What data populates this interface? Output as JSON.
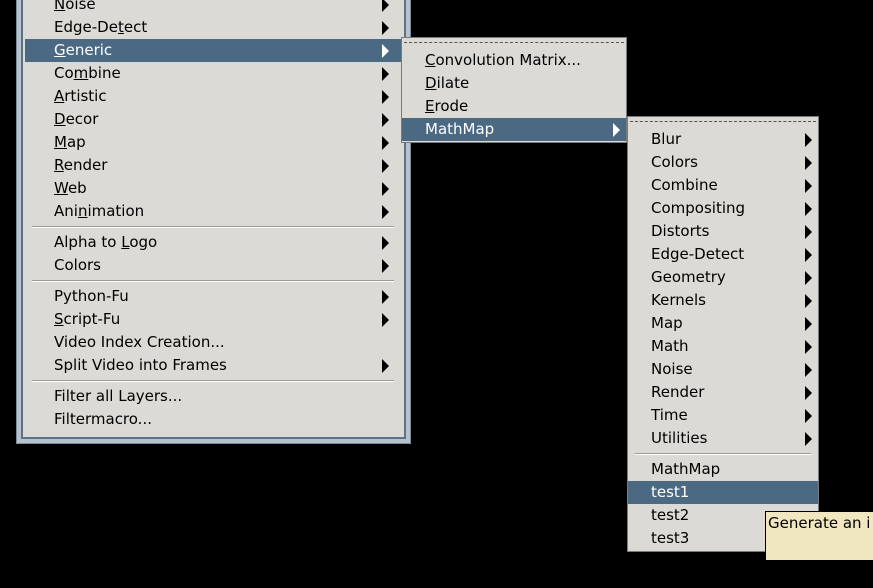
{
  "menu1": {
    "items": [
      {
        "label": "Noise",
        "ul": "N",
        "pre": "",
        "post": "oise",
        "submenu": true
      },
      {
        "label": "Edge-Detect",
        "ul": "t",
        "pre": "Edge-De",
        "post": "ect",
        "submenu": true
      },
      {
        "label": "Generic",
        "ul": "G",
        "pre": "",
        "post": "eneric",
        "submenu": true,
        "active": true
      },
      {
        "label": "Combine",
        "ul": "m",
        "pre": "Co",
        "post": "bine",
        "submenu": true
      },
      {
        "label": "Artistic",
        "ul": "A",
        "pre": "",
        "post": "rtistic",
        "submenu": true
      },
      {
        "label": "Decor",
        "ul": "D",
        "pre": "",
        "post": "ecor",
        "submenu": true
      },
      {
        "label": "Map",
        "ul": "M",
        "pre": "",
        "post": "ap",
        "submenu": true
      },
      {
        "label": "Render",
        "ul": "R",
        "pre": "",
        "post": "ender",
        "submenu": true
      },
      {
        "label": "Web",
        "ul": "W",
        "pre": "",
        "post": "eb",
        "submenu": true
      },
      {
        "label": "Animation",
        "ul": "n",
        "pre": "Ani",
        "post": "imation",
        "submenu": true
      },
      {
        "label": "Alpha to Logo",
        "ul": "L",
        "pre": "Alpha to ",
        "post": "ogo",
        "submenu": true
      },
      {
        "label": "Colors",
        "ul": "",
        "pre": "Colors",
        "post": "",
        "submenu": true
      },
      {
        "label": "Python-Fu",
        "ul": "",
        "pre": "Python-Fu",
        "post": "",
        "submenu": true
      },
      {
        "label": "Script-Fu",
        "ul": "S",
        "pre": "",
        "post": "cript-Fu",
        "submenu": true
      },
      {
        "label": "Video Index Creation...",
        "ul": "",
        "pre": "Video Index Creation...",
        "post": "",
        "submenu": false
      },
      {
        "label": "Split Video into Frames",
        "ul": "",
        "pre": "Split Video into Frames",
        "post": "",
        "submenu": true
      },
      {
        "label": "Filter all Layers...",
        "ul": "",
        "pre": "Filter all Layers...",
        "post": "",
        "submenu": false
      },
      {
        "label": "Filtermacro...",
        "ul": "",
        "pre": "Filtermacro...",
        "post": "",
        "submenu": false
      }
    ]
  },
  "menu2": {
    "items": [
      {
        "label": "Convolution Matrix...",
        "ul": "C",
        "pre": "",
        "post": "onvolution Matrix...",
        "submenu": false
      },
      {
        "label": "Dilate",
        "ul": "D",
        "pre": "",
        "post": "ilate",
        "submenu": false
      },
      {
        "label": "Erode",
        "ul": "E",
        "pre": "",
        "post": "rode",
        "submenu": false
      },
      {
        "label": "MathMap",
        "ul": "",
        "pre": "MathMap",
        "post": "",
        "submenu": true,
        "active": true
      }
    ]
  },
  "menu3": {
    "categories": [
      "Blur",
      "Colors",
      "Combine",
      "Compositing",
      "Distorts",
      "Edge-Detect",
      "Geometry",
      "Kernels",
      "Map",
      "Math",
      "Noise",
      "Render",
      "Time",
      "Utilities"
    ],
    "items": [
      "MathMap",
      "test1",
      "test2",
      "test3"
    ],
    "active_item": "test1"
  },
  "tooltip": {
    "text": "Generate an i"
  },
  "colors": {
    "menu_bg": "#dcdad5",
    "highlight": "#4b6983",
    "tooltip_bg": "#f0e6c0"
  }
}
